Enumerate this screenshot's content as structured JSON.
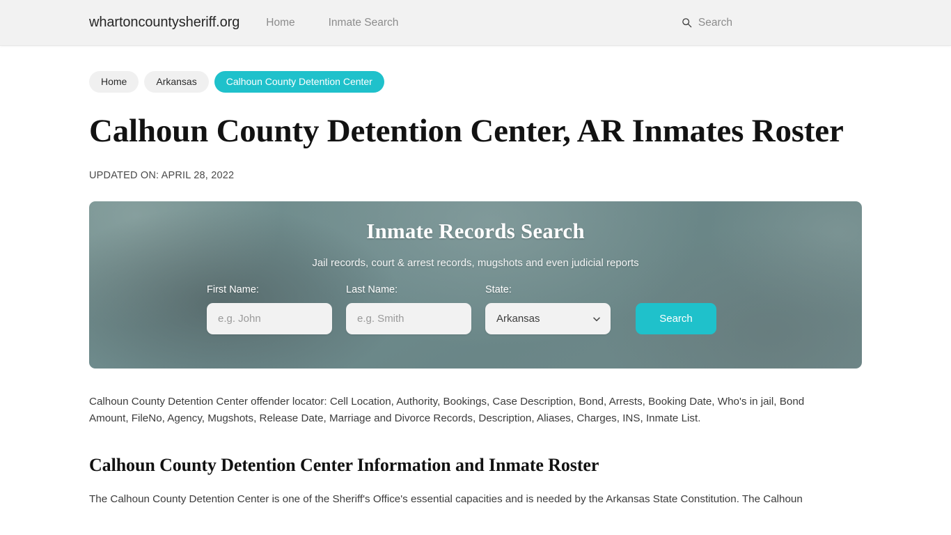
{
  "header": {
    "brand": "whartoncountysheriff.org",
    "nav": [
      {
        "label": "Home"
      },
      {
        "label": "Inmate Search"
      }
    ],
    "search": {
      "icon": "search-icon",
      "label": "Search"
    }
  },
  "breadcrumb": [
    {
      "label": "Home",
      "active": false
    },
    {
      "label": "Arkansas",
      "active": false
    },
    {
      "label": "Calhoun County Detention Center",
      "active": true
    }
  ],
  "page": {
    "title": "Calhoun County Detention Center, AR Inmates Roster",
    "updated_on": "UPDATED ON: APRIL 28, 2022"
  },
  "hero": {
    "title": "Inmate Records Search",
    "subtitle": "Jail records, court & arrest records, mugshots and even judicial reports",
    "fields": {
      "first_name": {
        "label": "First Name:",
        "placeholder": "e.g. John",
        "value": ""
      },
      "last_name": {
        "label": "Last Name:",
        "placeholder": "e.g. Smith",
        "value": ""
      },
      "state": {
        "label": "State:",
        "selected": "Arkansas",
        "options": [
          "Arkansas"
        ],
        "chevron": "chevron-down-icon"
      }
    },
    "submit_label": "Search"
  },
  "content": {
    "intro_paragraph": "Calhoun County Detention Center offender locator: Cell Location, Authority, Bookings, Case Description, Bond, Arrests, Booking Date, Who's in jail, Bond Amount, FileNo, Agency, Mugshots, Release Date, Marriage and Divorce Records, Description, Aliases, Charges, INS, Inmate List.",
    "section_heading": "Calhoun County Detention Center Information and Inmate Roster",
    "body_paragraph": "The Calhoun County Detention Center is one of the Sheriff's Office's essential capacities and is needed by the Arkansas State Constitution. The Calhoun"
  },
  "colors": {
    "accent_teal": "#1fc1cb",
    "header_bg": "#f2f2f2",
    "hero_bg": "#6d8a8c",
    "text_dark": "#121212",
    "text_muted": "#8c8c8c"
  }
}
